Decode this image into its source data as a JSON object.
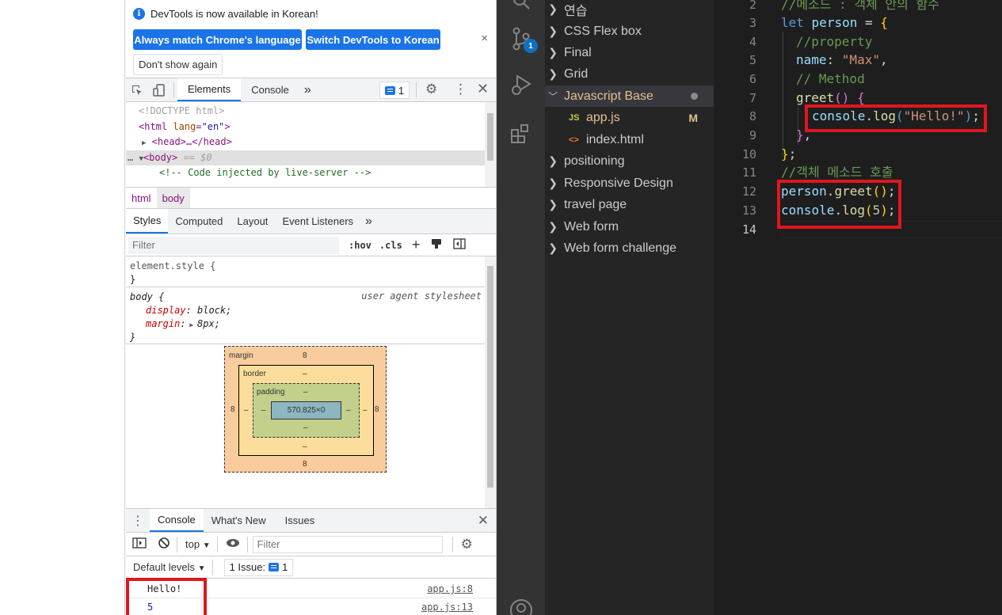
{
  "devtools": {
    "infobar": {
      "message": "DevTools is now available in Korean!",
      "match_language_button": "Always match Chrome's language",
      "switch_button": "Switch DevTools to Korean",
      "dont_show_button": "Don't show again",
      "close": "×"
    },
    "main_tabs": [
      "Elements",
      "Console"
    ],
    "more_tabs": "»",
    "issues_count": "1",
    "dom_tree": {
      "doctype": "<!DOCTYPE html>",
      "html_open": "<html",
      "lang_attr": "lang",
      "lang_val": "\"en\"",
      "html_close": ">",
      "head": "<head>…</head>",
      "body": "<body>",
      "body_suffix": "== $0",
      "comment": "<!-- Code injected by live-server -->",
      "ellipsis": "…"
    },
    "breadcrumbs": [
      "html",
      "body"
    ],
    "styles_tabs": [
      "Styles",
      "Computed",
      "Layout",
      "Event Listeners"
    ],
    "filter_placeholder": "Filter",
    "hov": ":hov",
    "cls": ".cls",
    "rules": {
      "element_style": "element.style {",
      "close_brace": "}",
      "body_selector": "body {",
      "source": "user agent stylesheet",
      "display_prop": "display",
      "display_val": "block;",
      "margin_prop": "margin",
      "margin_val": "8px;"
    },
    "box_model": {
      "margin_label": "margin",
      "border_label": "border",
      "padding_label": "padding",
      "margin_value": "8",
      "dash": "–",
      "content_size": "570.825×0"
    },
    "drawer_tabs": [
      "Console",
      "What's New",
      "Issues"
    ],
    "console": {
      "context": "top",
      "filter_placeholder": "Filter",
      "levels": "Default levels",
      "issue_chip_label": "1 Issue:",
      "issue_chip_count": "1",
      "messages": [
        {
          "text": "Hello!",
          "source": "app.js:8"
        },
        {
          "text": "5",
          "source": "app.js:13"
        }
      ]
    }
  },
  "vscode": {
    "badge": "1",
    "explorer_items": [
      {
        "label": "연습",
        "type": "folder-closed"
      },
      {
        "label": "CSS Flex box",
        "type": "folder-closed"
      },
      {
        "label": "Final",
        "type": "folder-closed"
      },
      {
        "label": "Grid",
        "type": "folder-closed"
      },
      {
        "label": "Javascript Base",
        "type": "folder-open"
      },
      {
        "label": "app.js",
        "type": "js-file",
        "badge": "M",
        "icon": "JS"
      },
      {
        "label": "index.html",
        "type": "html-file",
        "icon": "<>"
      },
      {
        "label": "positioning",
        "type": "folder-closed"
      },
      {
        "label": "Responsive Design",
        "type": "folder-closed"
      },
      {
        "label": "travel page",
        "type": "folder-closed"
      },
      {
        "label": "Web form",
        "type": "folder-closed"
      },
      {
        "label": "Web form challenge",
        "type": "folder-closed"
      }
    ],
    "line_numbers": [
      "2",
      "3",
      "4",
      "5",
      "6",
      "7",
      "8",
      "9",
      "10",
      "11",
      "12",
      "13",
      "14"
    ],
    "code": {
      "l2": "//메소드 : 객체 안의 함수",
      "l3_kw": "let",
      "l3_var": "person",
      "l3_eq": " = ",
      "l3_brace": "{",
      "l4": "//property",
      "l5_key": "name",
      "l5_colon": ": ",
      "l5_str": "\"Max\"",
      "l5_comma": ",",
      "l6": "// Method",
      "l7_fn": "greet",
      "l7_paren": "()",
      "l7_brace": " {",
      "l8_obj": "console",
      "l8_dot": ".",
      "l8_fn": "log",
      "l8_open": "(",
      "l8_str": "\"Hello!\"",
      "l8_close": ")",
      "l8_semi": ";",
      "l9_brace": "}",
      "l9_comma": ",",
      "l10_brace": "}",
      "l10_semi": ";",
      "l11": "//객체 메소드 호출",
      "l12_obj": "person",
      "l12_dot": ".",
      "l12_fn": "greet",
      "l12_paren": "()",
      "l12_semi": ";",
      "l13_obj": "console",
      "l13_dot": ".",
      "l13_fn": "log",
      "l13_open": "(",
      "l13_num": "5",
      "l13_close": ")",
      "l13_semi": ";"
    }
  }
}
